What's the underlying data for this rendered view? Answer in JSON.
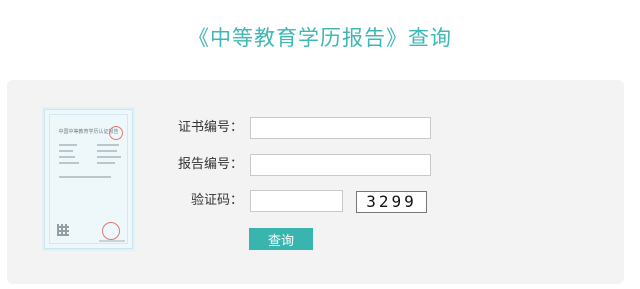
{
  "page": {
    "title": "《中等教育学历报告》查询"
  },
  "certificate": {
    "title": "中国中等教育学历认证报告"
  },
  "form": {
    "certificate_number": {
      "label": "证书编号：",
      "value": ""
    },
    "report_number": {
      "label": "报告编号：",
      "value": ""
    },
    "verification_code": {
      "label": "验证码：",
      "value": ""
    },
    "captcha_text": "3299",
    "submit_label": "查询"
  },
  "colors": {
    "accent": "#39b5b0",
    "title": "#3fb8b4",
    "panel": "#f3f3f3"
  }
}
